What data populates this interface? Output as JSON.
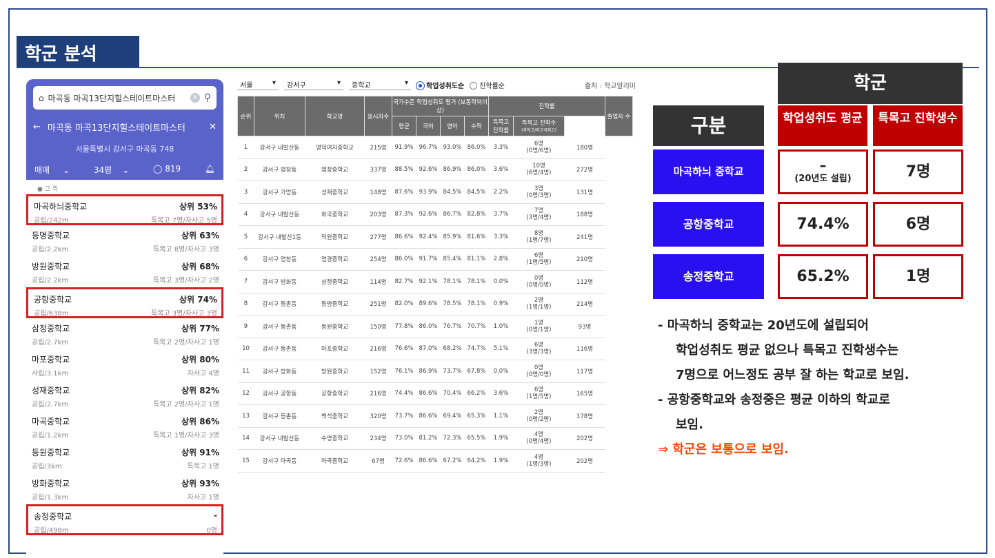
{
  "slide": {
    "title": "학군 분석"
  },
  "app": {
    "search_text": "마곡동 마곡13단지힐스테이트마스터",
    "location_title": "마곡동 마곡13단지힐스테이트마스터",
    "address": "서울특별시 강서구 마곡동 748",
    "deal_type": "매매",
    "size": "34평",
    "comments": "819",
    "rank_caption": "● 그 위",
    "schools": [
      {
        "name": "마곡하늬중학교",
        "rank": "상위 53%",
        "info": "공립/242m",
        "extra": "특목고 7명/자사고 5명"
      },
      {
        "name": "등명중학교",
        "rank": "상위 63%",
        "info": "공립/2.2km",
        "extra": "특목고 8명/자사고 3명"
      },
      {
        "name": "방원중학교",
        "rank": "상위 68%",
        "info": "공립/2.2km",
        "extra": "특목고 3명/자사고 2명"
      },
      {
        "name": "공항중학교",
        "rank": "상위 74%",
        "info": "공립/638m",
        "extra": "특목고 3명/자사고 3명"
      },
      {
        "name": "삼정중학교",
        "rank": "상위 77%",
        "info": "공립/2.7km",
        "extra": "특목고 2명/자사고 1명"
      },
      {
        "name": "마포중학교",
        "rank": "상위 80%",
        "info": "사립/3.1km",
        "extra": "자사고 4명"
      },
      {
        "name": "성재중학교",
        "rank": "상위 82%",
        "info": "공립/2.7km",
        "extra": "특목고 2명/자사고 1명"
      },
      {
        "name": "마곡중학교",
        "rank": "상위 86%",
        "info": "공립/1.2km",
        "extra": "특목고 1명/자사고 3명"
      },
      {
        "name": "등원중학교",
        "rank": "상위 91%",
        "info": "공립/3km",
        "extra": "특목고 1명"
      },
      {
        "name": "방화중학교",
        "rank": "상위 93%",
        "info": "공립/1.3km",
        "extra": "자사고 1명"
      },
      {
        "name": "송정중학교",
        "rank": "-",
        "info": "공립/498m",
        "extra": "0명"
      }
    ]
  },
  "table": {
    "filters": {
      "city": "서울",
      "district": "강서구",
      "level": "중학교",
      "sort_a": "학업성취도순",
      "sort_b": "진학률순",
      "source": "출처 : 학교알리미"
    },
    "headers": {
      "rank": "순위",
      "loc": "위치",
      "school": "학교명",
      "students": "응시자수",
      "group_eval": "국가수준 학업성취도 평가 (보통학력이상)",
      "avg": "평균",
      "kor": "국어",
      "eng": "영어",
      "math": "수학",
      "group_adv": "진학률",
      "sp_rate": "특목고 진학률",
      "sp_count": "특목고 진학수",
      "sp_count_sub": "(과학고/외고국제고)",
      "grad": "졸업자 수"
    },
    "rows": [
      {
        "rank": "1",
        "loc": "강서구 내발산동",
        "school": "명덕여자중학교",
        "n": "215명",
        "avg": "91.9%",
        "kor": "96.7%",
        "eng": "93.0%",
        "math": "86.0%",
        "rate": "3.3%",
        "cnt": "6명",
        "cnt2": "(0명/6명)",
        "grad": "180명"
      },
      {
        "rank": "2",
        "loc": "강서구 염창동",
        "school": "염창중학교",
        "n": "337명",
        "avg": "88.5%",
        "kor": "92.6%",
        "eng": "86.9%",
        "math": "86.0%",
        "rate": "3.6%",
        "cnt": "10명",
        "cnt2": "(6명/4명)",
        "grad": "272명"
      },
      {
        "rank": "3",
        "loc": "강서구 가양동",
        "school": "성재중학교",
        "n": "148명",
        "avg": "87.6%",
        "kor": "93.9%",
        "eng": "84.5%",
        "math": "84.5%",
        "rate": "2.2%",
        "cnt": "3명",
        "cnt2": "(0명/3명)",
        "grad": "131명"
      },
      {
        "rank": "4",
        "loc": "강서구 내발산동",
        "school": "화곡중학교",
        "n": "203명",
        "avg": "87.3%",
        "kor": "92.6%",
        "eng": "86.7%",
        "math": "82.8%",
        "rate": "3.7%",
        "cnt": "7명",
        "cnt2": "(3명/4명)",
        "grad": "188명"
      },
      {
        "rank": "5",
        "loc": "강서구 내발산1동",
        "school": "덕원중학교",
        "n": "277명",
        "avg": "86.6%",
        "kor": "92.4%",
        "eng": "85.9%",
        "math": "81.6%",
        "rate": "3.3%",
        "cnt": "8명",
        "cnt2": "(1명/7명)",
        "grad": "241명"
      },
      {
        "rank": "6",
        "loc": "강서구 염창동",
        "school": "염경중학교",
        "n": "254명",
        "avg": "86.0%",
        "kor": "91.7%",
        "eng": "85.4%",
        "math": "81.1%",
        "rate": "2.8%",
        "cnt": "6명",
        "cnt2": "(1명/5명)",
        "grad": "210명"
      },
      {
        "rank": "7",
        "loc": "강서구 방화동",
        "school": "삼정중학교",
        "n": "114명",
        "avg": "82.7%",
        "kor": "92.1%",
        "eng": "78.1%",
        "math": "78.1%",
        "rate": "0.0%",
        "cnt": "0명",
        "cnt2": "(0명/0명)",
        "grad": "112명"
      },
      {
        "rank": "8",
        "loc": "강서구 등촌동",
        "school": "등명중학교",
        "n": "251명",
        "avg": "82.0%",
        "kor": "89.6%",
        "eng": "78.5%",
        "math": "78.1%",
        "rate": "0.9%",
        "cnt": "2명",
        "cnt2": "(1명/1명)",
        "grad": "214명"
      },
      {
        "rank": "9",
        "loc": "강서구 등촌동",
        "school": "등원중학교",
        "n": "150명",
        "avg": "77.8%",
        "kor": "86.0%",
        "eng": "76.7%",
        "math": "70.7%",
        "rate": "1.0%",
        "cnt": "1명",
        "cnt2": "(0명/1명)",
        "grad": "93명"
      },
      {
        "rank": "10",
        "loc": "강서구 등촌동",
        "school": "마포중학교",
        "n": "216명",
        "avg": "76.6%",
        "kor": "87.0%",
        "eng": "68.2%",
        "math": "74.7%",
        "rate": "5.1%",
        "cnt": "6명",
        "cnt2": "(3명/3명)",
        "grad": "116명"
      },
      {
        "rank": "11",
        "loc": "강서구 방화동",
        "school": "방원중학교",
        "n": "152명",
        "avg": "76.1%",
        "kor": "86.9%",
        "eng": "73.7%",
        "math": "67.8%",
        "rate": "0.0%",
        "cnt": "0명",
        "cnt2": "(0명/0명)",
        "grad": "117명"
      },
      {
        "rank": "12",
        "loc": "강서구 공항동",
        "school": "공항중학교",
        "n": "216명",
        "avg": "74.4%",
        "kor": "86.6%",
        "eng": "70.4%",
        "math": "66.2%",
        "rate": "3.6%",
        "cnt": "6명",
        "cnt2": "(1명/5명)",
        "grad": "165명"
      },
      {
        "rank": "13",
        "loc": "강서구 등촌동",
        "school": "백석중학교",
        "n": "320명",
        "avg": "73.7%",
        "kor": "86.6%",
        "eng": "69.4%",
        "math": "65.3%",
        "rate": "1.1%",
        "cnt": "2명",
        "cnt2": "(0명/2명)",
        "grad": "178명"
      },
      {
        "rank": "14",
        "loc": "강서구 내발산동",
        "school": "수명중학교",
        "n": "234명",
        "avg": "73.0%",
        "kor": "81.2%",
        "eng": "72.3%",
        "math": "65.5%",
        "rate": "1.9%",
        "cnt": "4명",
        "cnt2": "(0명/4명)",
        "grad": "202명"
      },
      {
        "rank": "15",
        "loc": "강서구 마곡동",
        "school": "마곡중학교",
        "n": "67명",
        "avg": "72.6%",
        "kor": "86.6%",
        "eng": "67.2%",
        "math": "64.2%",
        "rate": "1.9%",
        "cnt": "4명",
        "cnt2": "(1명/3명)",
        "grad": "202명"
      }
    ]
  },
  "summary": {
    "school_header": "학군",
    "gubun": "구분",
    "col1": "학업성취도 평균",
    "col2": "특목고 진학생수",
    "rows": [
      {
        "name": "마곡하늬 중학교",
        "avg_main": "–",
        "avg_sub": "(20년도 설립)",
        "count": "7명"
      },
      {
        "name": "공항중학교",
        "avg": "74.4%",
        "count": "6명"
      },
      {
        "name": "송정중학교",
        "avg": "65.2%",
        "count": "1명"
      }
    ],
    "notes": [
      "- 마곡하늬 중학교는 20년도에 설립되어",
      "학업성취도 평균 없으나 특목고 진학생수는",
      "7명으로 어느정도 공부 잘 하는 학교로 보임.",
      "- 공항중학교와 송정중은 평균 이하의 학교로",
      "보임."
    ],
    "conclusion": "⇒ 학군은 보통으로 보임."
  },
  "colors": {
    "brand_blue": "#1f3f7a",
    "app_purple": "#5a63c9",
    "accent_red": "#c00000",
    "row_blue": "#2a10f0",
    "highlight": "#d81e1e"
  }
}
